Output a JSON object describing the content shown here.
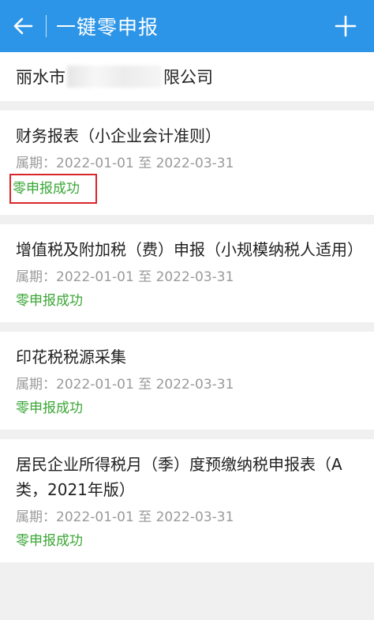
{
  "header": {
    "title": "一键零申报",
    "bg_color": "#2d95e8"
  },
  "company": {
    "left": "丽水市",
    "right": "限公司"
  },
  "items": [
    {
      "name": "财务报表（小企业会计准则）",
      "period": "属期：2022-01-01 至 2022-03-31",
      "status": "零申报成功"
    },
    {
      "name": "增值税及附加税（费）申报（小规模纳税人适用）",
      "period": "属期：2022-01-01 至 2022-03-31",
      "status": "零申报成功"
    },
    {
      "name": "印花税税源采集",
      "period": "属期：2022-01-01 至 2022-03-31",
      "status": "零申报成功"
    },
    {
      "name": "居民企业所得税月（季）度预缴纳税申报表（A类，2021年版）",
      "period": "属期：2022-01-01 至 2022-03-31",
      "status": "零申报成功"
    }
  ],
  "colors": {
    "status_green": "#3aa635",
    "highlight_red": "#d9262a"
  }
}
